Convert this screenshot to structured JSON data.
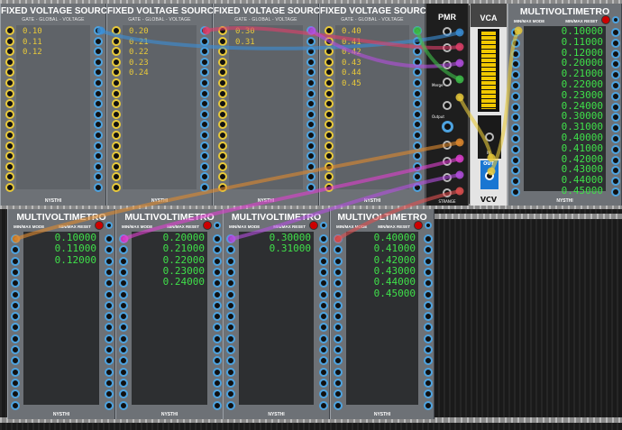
{
  "brand": "NYSTHI",
  "colors": {
    "blue_jack": "#4da3e0",
    "yellow_jack": "#e8c93a",
    "yellow_text": "#e8c93a",
    "green_text": "#3fe04a",
    "reset": "#cc0000"
  },
  "fvs": {
    "title": "FIXED VOLTAGE SOURCE",
    "subtitle": "GATE - GLOBAL - VOLTAGE",
    "modules": [
      {
        "values": [
          "0.10",
          "0.11",
          "0.12"
        ]
      },
      {
        "values": [
          "0.20",
          "0.21",
          "0.22",
          "0.23",
          "0.24"
        ]
      },
      {
        "values": [
          "0.30",
          "0.31"
        ]
      },
      {
        "values": [
          "0.40",
          "0.41",
          "0.42",
          "0.43",
          "0.44",
          "0.45"
        ]
      }
    ]
  },
  "mv": {
    "title": "MULTIVOLTIMETRO",
    "minmax_label": "MIN/MAX MODE",
    "reset_label": "MIN/MAX RESET",
    "modules": [
      {
        "values": [
          "0.10000",
          "0.11000",
          "0.12000"
        ]
      },
      {
        "values": [
          "0.20000",
          "0.21000",
          "0.22000",
          "0.23000",
          "0.24000"
        ]
      },
      {
        "values": [
          "0.30000",
          "0.31000"
        ]
      },
      {
        "values": [
          "0.40000",
          "0.41000",
          "0.42000",
          "0.43000",
          "0.44000",
          "0.45000"
        ]
      },
      {
        "values": [
          "0.10000",
          "0.11000",
          "0.12000",
          "0.20000",
          "0.21000",
          "0.22000",
          "0.23000",
          "0.24000",
          "0.30000",
          "0.31000",
          "0.40000",
          "0.41000",
          "0.42000",
          "0.43000",
          "0.44000",
          "0.45000"
        ]
      }
    ]
  },
  "pmr": {
    "title": "PMR",
    "merge_label": "Merge",
    "output_label": "Output",
    "maker": "STRANGE"
  },
  "vca": {
    "title": "VCA",
    "in_label": "IN",
    "out_label": "OUT",
    "footer": "VCV"
  }
}
